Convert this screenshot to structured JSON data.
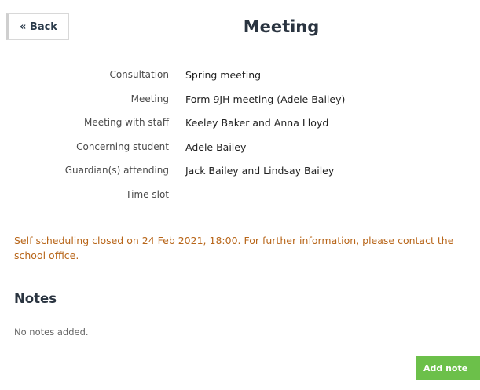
{
  "header": {
    "back_label": "« Back",
    "title": "Meeting"
  },
  "details": [
    {
      "label": "Consultation",
      "value": "Spring meeting"
    },
    {
      "label": "Meeting",
      "value": "Form 9JH meeting (Adele Bailey)"
    },
    {
      "label": "Meeting with staff",
      "value": "Keeley Baker and Anna Lloyd"
    },
    {
      "label": "Concerning student",
      "value": "Adele Bailey"
    },
    {
      "label": "Guardian(s) attending",
      "value": "Jack Bailey and Lindsay Bailey"
    },
    {
      "label": "Time slot",
      "value": ""
    }
  ],
  "notice": "Self scheduling closed on 24 Feb 2021, 18:00. For further information, please contact the school office.",
  "notes": {
    "heading": "Notes",
    "empty_text": "No notes added.",
    "add_label": "Add note"
  },
  "colors": {
    "notice": "#b8661a",
    "add_button": "#6cc04a",
    "heading": "#2a3440"
  }
}
